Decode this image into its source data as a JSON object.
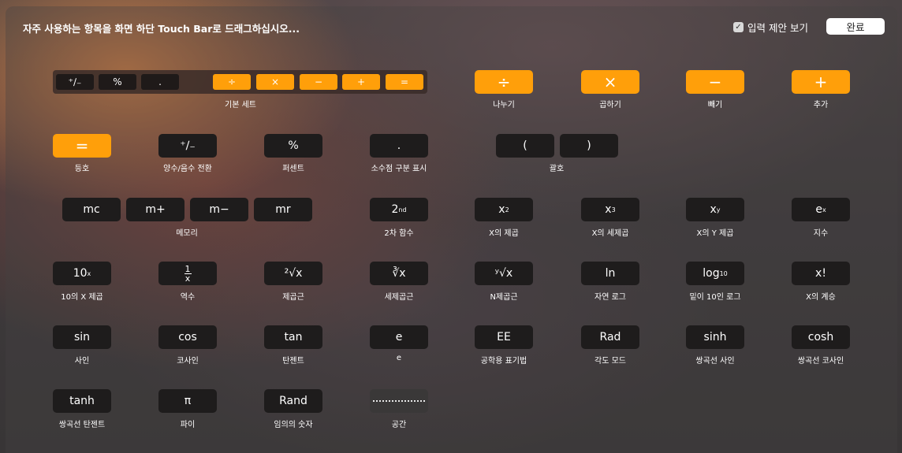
{
  "header": {
    "instruction": "자주 사용하는 항목을 화면 하단 Touch Bar로 드래그하십시오...",
    "show_typing_suggestions_label": "입력 제안 보기",
    "show_typing_suggestions_checked": true,
    "done_label": "완료"
  },
  "colors": {
    "accent_orange": "#ff9f0a",
    "key_dark": "#1e1c1c",
    "done_button": "#ffffff"
  },
  "basic_set": {
    "keys": [
      "⁺∕₋",
      "%",
      ".",
      "÷",
      "×",
      "−",
      "+",
      "="
    ],
    "label": "기본 세트"
  },
  "items": {
    "divide": {
      "key": "÷",
      "label": "나누기"
    },
    "multiply": {
      "key": "×",
      "label": "곱하기"
    },
    "subtract": {
      "key": "−",
      "label": "빼기"
    },
    "add": {
      "key": "+",
      "label": "추가"
    },
    "equals": {
      "key": "=",
      "label": "등호"
    },
    "negate": {
      "key": "⁺∕₋",
      "label": "양수/음수 전환"
    },
    "percent": {
      "key": "%",
      "label": "퍼센트"
    },
    "decimal": {
      "key": ".",
      "label": "소수점 구분 표시"
    },
    "open_paren": {
      "key": "("
    },
    "close_paren": {
      "key": ")"
    },
    "parens_label": "괄호",
    "mc": {
      "key": "mc"
    },
    "mplus": {
      "key": "m+"
    },
    "mminus": {
      "key": "m−"
    },
    "mr": {
      "key": "mr"
    },
    "memory_label": "메모리",
    "second": {
      "base": "2",
      "sup": "nd",
      "label": "2차 함수"
    },
    "x_squared": {
      "base": "x",
      "sup": "2",
      "label": "X의 제곱"
    },
    "x_cubed": {
      "base": "x",
      "sup": "3",
      "label": "X의 세제곱"
    },
    "x_to_y": {
      "base": "x",
      "sup": "y",
      "label": "X의 Y 제곱"
    },
    "e_to_x": {
      "base": "e",
      "sup": "x",
      "label": "지수"
    },
    "ten_to_x": {
      "base": "10",
      "sup": "x",
      "label": "10의 X 제곱"
    },
    "reciprocal": {
      "num": "1",
      "den": "x",
      "label": "역수"
    },
    "square_root": {
      "key": "²√x",
      "label": "제곱근"
    },
    "cube_root": {
      "key": "∛x",
      "label": "세제곱근"
    },
    "nth_root": {
      "key": "ʸ√x",
      "label": "N제곱근"
    },
    "ln": {
      "key": "ln",
      "label": "자연 로그"
    },
    "log10": {
      "base": "log",
      "sub": "10",
      "label": "밑이 10인 로그"
    },
    "factorial": {
      "key": "x!",
      "label": "X의 계승"
    },
    "sin": {
      "key": "sin",
      "label": "사인"
    },
    "cos": {
      "key": "cos",
      "label": "코사인"
    },
    "tan": {
      "key": "tan",
      "label": "탄젠트"
    },
    "e": {
      "key": "e",
      "label": "e"
    },
    "ee": {
      "key": "EE",
      "label": "공학용 표기법"
    },
    "rad": {
      "key": "Rad",
      "label": "각도 모드"
    },
    "sinh": {
      "key": "sinh",
      "label": "쌍곡선 사인"
    },
    "cosh": {
      "key": "cosh",
      "label": "쌍곡선 코사인"
    },
    "tanh": {
      "key": "tanh",
      "label": "쌍곡선 탄젠트"
    },
    "pi": {
      "key": "π",
      "label": "파이"
    },
    "rand": {
      "key": "Rand",
      "label": "임의의 숫자"
    },
    "space": {
      "label": "공간"
    }
  }
}
